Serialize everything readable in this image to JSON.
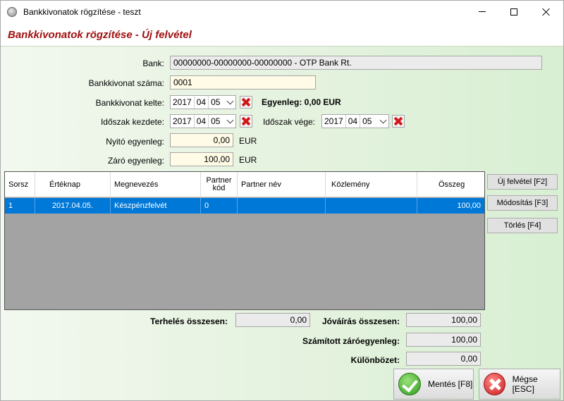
{
  "window": {
    "title": "Bankkivonatok rögzítése - teszt"
  },
  "header": {
    "title": "Bankkivonatok rögzítése - Új felvétel"
  },
  "form": {
    "bank_label": "Bank:",
    "bank_value": "00000000-00000000-00000000 - OTP Bank Rt.",
    "number_label": "Bankkivonat száma:",
    "number_value": "0001",
    "date_label": "Bankkivonat kelte:",
    "date": {
      "year": "2017",
      "month": "04",
      "day": "05"
    },
    "balance_text": "Egyenleg: 0,00 EUR",
    "period_start_label": "Időszak kezdete:",
    "period_start": {
      "year": "2017",
      "month": "04",
      "day": "05"
    },
    "period_end_label": "Időszak vége:",
    "period_end": {
      "year": "2017",
      "month": "04",
      "day": "05"
    },
    "opening_label": "Nyitó egyenleg:",
    "opening_value": "0,00",
    "opening_unit": "EUR",
    "closing_label": "Záró egyenleg:",
    "closing_value": "100,00",
    "closing_unit": "EUR"
  },
  "grid": {
    "columns": [
      "Sorsz",
      "Értéknap",
      "Megnevezés",
      "Partner kód",
      "Partner név",
      "Közlemény",
      "Összeg"
    ],
    "rows": [
      [
        "1",
        "2017.04.05.",
        "Készpénzfelvét",
        "0",
        "",
        "",
        "100,00"
      ]
    ]
  },
  "side_buttons": {
    "new": "Új felvétel [F2]",
    "edit": "Módosítás [F3]",
    "delete": "Törlés [F4]"
  },
  "totals": {
    "debit_label": "Terhelés összesen:",
    "debit_value": "0,00",
    "credit_label": "Jóváírás összesen:",
    "credit_value": "100,00",
    "computed_label": "Számított záróegyenleg:",
    "computed_value": "100,00",
    "diff_label": "Különbözet:",
    "diff_value": "0,00"
  },
  "actions": {
    "save": "Mentés [F8]",
    "cancel": "Mégse [ESC]"
  },
  "colors": {
    "header_title": "#a01010",
    "selection": "#0078d7",
    "edit_field": "#fffbe6"
  }
}
